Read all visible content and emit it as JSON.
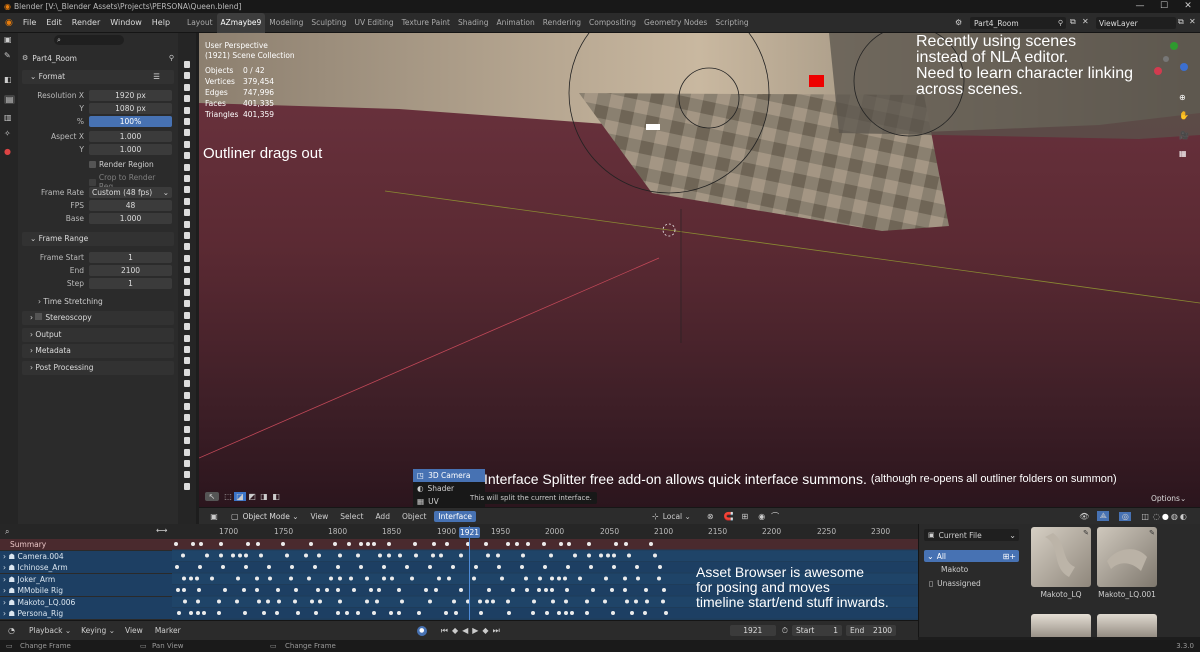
{
  "window": {
    "title": "Blender [V:\\_Blender Assets\\Projects\\PERSONA\\Queen.blend]",
    "min": "—",
    "max": "☐",
    "close": "✕"
  },
  "menu": [
    "File",
    "Edit",
    "Render",
    "Window",
    "Help"
  ],
  "workspaces": [
    "Layout",
    "AZmaybe9",
    "Modeling",
    "Sculpting",
    "UV Editing",
    "Texture Paint",
    "Shading",
    "Animation",
    "Rendering",
    "Compositing",
    "Geometry Nodes",
    "Scripting"
  ],
  "active_workspace": "AZmaybe9",
  "scene": "Part4_Room",
  "view_layer": "ViewLayer",
  "properties": {
    "scene_name": "Part4_Room",
    "format_label": "Format",
    "res_x_label": "Resolution X",
    "res_x": "1920 px",
    "res_y_label": "Y",
    "res_y": "1080 px",
    "pct_label": "%",
    "pct": "100%",
    "aspect_x_label": "Aspect X",
    "aspect_x": "1.000",
    "aspect_y_label": "Y",
    "aspect_y": "1.000",
    "render_region": "Render Region",
    "crop": "Crop to Render Reg...",
    "frame_rate_label": "Frame Rate",
    "frame_rate": "Custom (48 fps)",
    "fps_label": "FPS",
    "fps": "48",
    "base_label": "Base",
    "base": "1.000",
    "frame_range_label": "Frame Range",
    "fstart_label": "Frame Start",
    "fstart": "1",
    "fend_label": "End",
    "fend": "2100",
    "step_label": "Step",
    "step": "1",
    "time_stretching": "Time Stretching",
    "stereoscopy": "Stereoscopy",
    "output": "Output",
    "metadata": "Metadata",
    "post_processing": "Post Processing"
  },
  "viewport": {
    "perspective": "User Perspective",
    "collection": "(1921) Scene Collection",
    "stats": [
      {
        "k": "Objects",
        "v": "0 / 42"
      },
      {
        "k": "Vertices",
        "v": "379,454"
      },
      {
        "k": "Edges",
        "v": "747,996"
      },
      {
        "k": "Faces",
        "v": "401,335"
      },
      {
        "k": "Triangles",
        "v": "401,359"
      }
    ],
    "options": "Options"
  },
  "annotations": {
    "scenes": "Recently using scenes\ninstead of NLA editor.\nNeed to learn character linking\nacross scenes.",
    "outliner": "Outliner drags out",
    "splitter_main": "Interface Splitter free add-on allows quick interface summons.",
    "splitter_note": "(although re-opens all outliner folders on summon)",
    "assets": "Asset Browser is awesome\nfor posing and moves\ntimeline start/end stuff inwards."
  },
  "popup": {
    "items": [
      "3D Camera",
      "Shader",
      "UV"
    ],
    "tooltip": "This will split the current interface."
  },
  "viewport_header": {
    "mode": "Object Mode",
    "menus": [
      "View",
      "Select",
      "Add",
      "Object",
      "Interface"
    ],
    "orientation": "Local"
  },
  "dopesheet": {
    "summary": "Summary",
    "channels": [
      "Camera.004",
      "Ichinose_Arm",
      "Joker_Arm",
      "MMobile Rig",
      "Makoto_LQ.006",
      "Persona_Rig"
    ],
    "ticks": [
      "1700",
      "1750",
      "1800",
      "1850",
      "1900",
      "1921",
      "1950",
      "2000",
      "2050",
      "2100",
      "2150",
      "2200",
      "2250",
      "2300"
    ],
    "current": "1921"
  },
  "timeline": {
    "menus": [
      "Playback",
      "Keying",
      "View",
      "Marker"
    ],
    "frame": "1921",
    "start_label": "Start",
    "start": "1",
    "end_label": "End",
    "end": "2100"
  },
  "asset_browser": {
    "library": "Current File",
    "catalogs": [
      "All",
      "Makoto",
      "Unassigned"
    ],
    "assets": [
      "Makoto_LQ",
      "Makoto_LQ.001"
    ]
  },
  "statusbar": [
    "Change Frame",
    "Pan View",
    "Change Frame"
  ],
  "version": "3.3.0"
}
